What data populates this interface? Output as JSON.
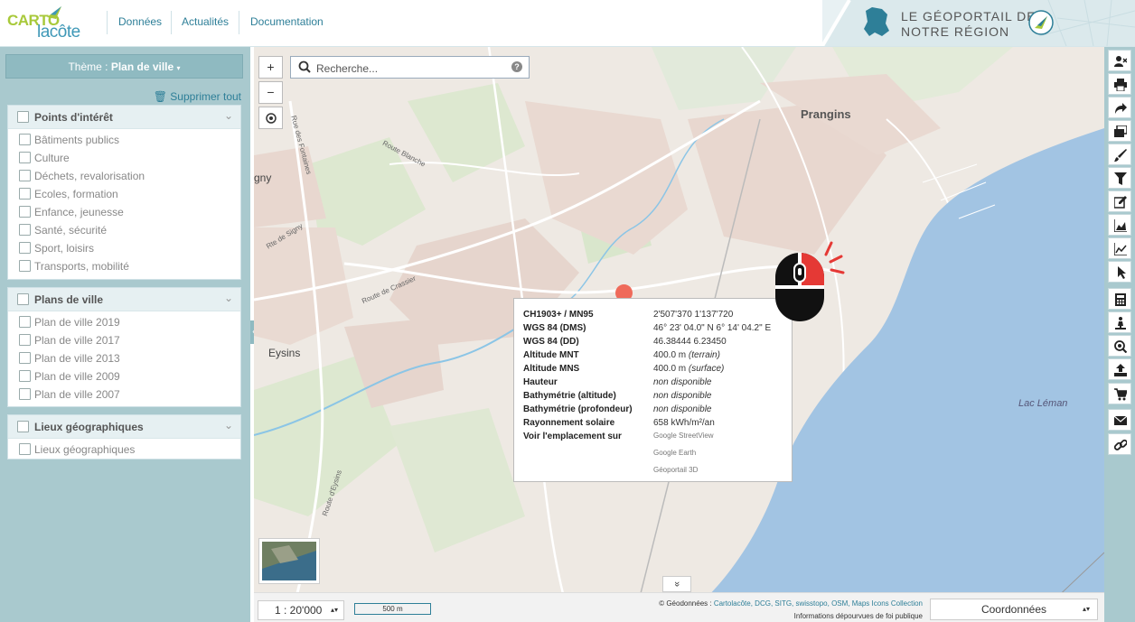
{
  "header": {
    "logo_top": "CARTO",
    "logo_bottom": "lacôte",
    "nav": [
      "Données",
      "Actualités",
      "Documentation"
    ],
    "banner_line1": "LE GÉOPORTAIL DE",
    "banner_line2": "NOTRE RÉGION"
  },
  "sidebar": {
    "theme_label": "Thème : ",
    "theme_value": "Plan de ville",
    "delete_all": "Supprimer tout",
    "panels": [
      {
        "title": "Points d'intérêt",
        "items": [
          "Bâtiments publics",
          "Culture",
          "Déchets, revalorisation",
          "Ecoles, formation",
          "Enfance, jeunesse",
          "Santé, sécurité",
          "Sport, loisirs",
          "Transports, mobilité"
        ]
      },
      {
        "title": "Plans de ville",
        "items": [
          "Plan de ville 2019",
          "Plan de ville 2017",
          "Plan de ville 2013",
          "Plan de ville 2009",
          "Plan de ville 2007"
        ]
      },
      {
        "title": "Lieux géographiques",
        "items": [
          "Lieux géographiques"
        ]
      }
    ]
  },
  "map": {
    "zoom_in": "+",
    "zoom_out": "−",
    "search_placeholder": "Recherche...",
    "places": {
      "prangins": "Prangins",
      "gny": "gny",
      "eysins": "Eysins",
      "lac": "Lac Léman"
    },
    "roads": {
      "fontaines": "Rue des Fontaines",
      "blanche": "Route Blanche",
      "signy": "Rte de Signy",
      "crassier": "Route de Crassier",
      "eysins_rte": "Route d'Eysins"
    },
    "popup": {
      "rows": [
        {
          "k": "CH1903+ / MN95",
          "v": "2'507'370 1'137'720"
        },
        {
          "k": "WGS 84 (DMS)",
          "v": "46° 23' 04.0\" N 6° 14' 04.2\" E"
        },
        {
          "k": "WGS 84 (DD)",
          "v": "46.38444 6.23450"
        },
        {
          "k": "Altitude MNT",
          "v": "400.0 m",
          "note": "(terrain)"
        },
        {
          "k": "Altitude MNS",
          "v": "400.0 m",
          "note": "(surface)"
        },
        {
          "k": "Hauteur",
          "v": "non disponible"
        },
        {
          "k": "Bathymétrie (altitude)",
          "v": "non disponible"
        },
        {
          "k": "Bathymétrie (profondeur)",
          "v": "non disponible"
        },
        {
          "k": "Rayonnement solaire",
          "v": "658 kWh/m²/an"
        },
        {
          "k": "Voir l'emplacement sur",
          "links": [
            "Google StreetView",
            "Google Earth",
            "Géoportail 3D"
          ]
        }
      ]
    },
    "expand": "»"
  },
  "bottombar": {
    "scale": "1 : 20'000",
    "scalebar": "500 m",
    "credits_prefix": "© Géodonnées : ",
    "credits_links": "Cartolacôte, DCG, SITG, swisstopo, OSM, Maps Icons Collection",
    "credits_line2": "Informations dépourvues de foi publique",
    "coord_select": "Coordonnées"
  },
  "toolbar": [
    "user-x-icon",
    "print-icon",
    "share-icon",
    "layers-icon",
    "brush-icon",
    "filter-icon",
    "edit-icon",
    "profile-chart-icon",
    "line-chart-icon",
    "pointer-icon",
    "calculator-icon",
    "person-icon",
    "zoom-icon",
    "upload-icon",
    "cart-icon",
    "mail-icon",
    "link-icon"
  ]
}
